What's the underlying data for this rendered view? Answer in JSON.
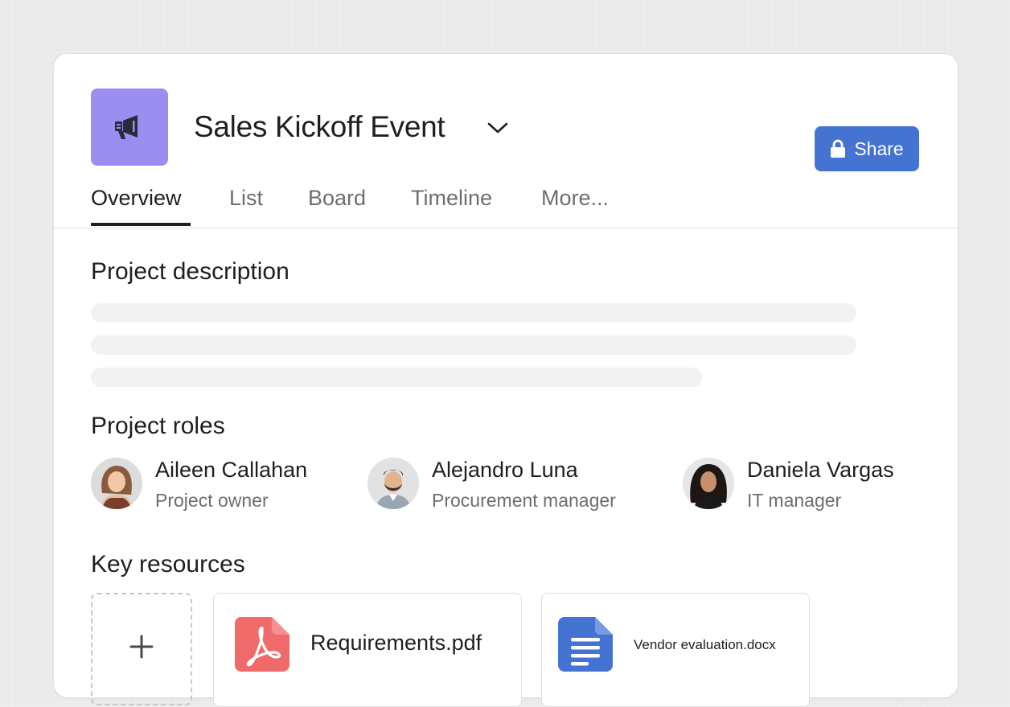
{
  "project": {
    "title": "Sales Kickoff Event",
    "icon": "megaphone-icon",
    "accent_color": "#9b8ef0"
  },
  "share_button": {
    "label": "Share",
    "icon": "lock-icon",
    "color": "#4573d2"
  },
  "tabs": [
    {
      "label": "Overview",
      "active": true
    },
    {
      "label": "List",
      "active": false
    },
    {
      "label": "Board",
      "active": false
    },
    {
      "label": "Timeline",
      "active": false
    },
    {
      "label": "More...",
      "active": false
    }
  ],
  "sections": {
    "description_title": "Project description",
    "roles_title": "Project roles",
    "resources_title": "Key resources"
  },
  "roles": [
    {
      "name": "Aileen Callahan",
      "role": "Project owner"
    },
    {
      "name": "Alejandro Luna",
      "role": "Procurement manager"
    },
    {
      "name": "Daniela Vargas",
      "role": "IT manager"
    }
  ],
  "resources": {
    "add_icon": "plus-icon",
    "files": [
      {
        "name": "Requirements.pdf",
        "icon": "pdf-icon",
        "color": "#f06a6a"
      },
      {
        "name": "Vendor evaluation.docx",
        "icon": "doc-icon",
        "color": "#4573d2"
      }
    ]
  }
}
